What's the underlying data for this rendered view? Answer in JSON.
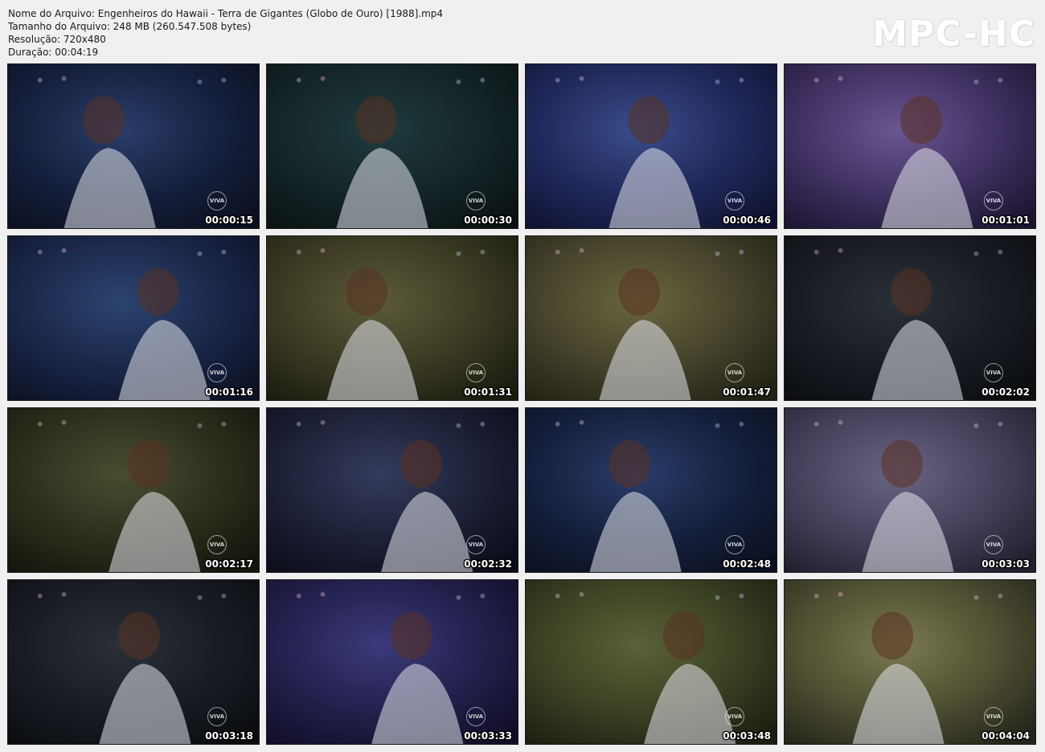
{
  "file_info": {
    "filename": "Nome do Arquivo: Engenheiros do Hawaii - Terra de Gigantes (Globo de Ouro) [1988].mp4",
    "filesize": "Tamanho do Arquivo: 248 MB (260.547.508 bytes)",
    "resolution": "Resolução: 720x480",
    "duration": "Duração: 00:04:19"
  },
  "branding": {
    "app_logo": "MPC-HC",
    "channel_logo": "VIVA"
  },
  "thumbnails": [
    {
      "timestamp": "00:00:15",
      "palette": "blue-dark"
    },
    {
      "timestamp": "00:00:30",
      "palette": "dark-teal"
    },
    {
      "timestamp": "00:00:46",
      "palette": "blue-stage"
    },
    {
      "timestamp": "00:01:01",
      "palette": "purple"
    },
    {
      "timestamp": "00:01:16",
      "palette": "blue-crowd"
    },
    {
      "timestamp": "00:01:31",
      "palette": "olive"
    },
    {
      "timestamp": "00:01:47",
      "palette": "olive-overlay"
    },
    {
      "timestamp": "00:02:02",
      "palette": "stage-top"
    },
    {
      "timestamp": "00:02:17",
      "palette": "olive-crowd"
    },
    {
      "timestamp": "00:02:32",
      "palette": "stage-wide"
    },
    {
      "timestamp": "00:02:48",
      "palette": "blue-dark"
    },
    {
      "timestamp": "00:03:03",
      "palette": "purple-grey"
    },
    {
      "timestamp": "00:03:18",
      "palette": "stage-top"
    },
    {
      "timestamp": "00:03:33",
      "palette": "blue-purple"
    },
    {
      "timestamp": "00:03:48",
      "palette": "olive-green"
    },
    {
      "timestamp": "00:04:04",
      "palette": "olive-light"
    }
  ],
  "colors": {
    "background": "#f0f0f0",
    "text": "#1a1a1a",
    "logo": "#ffffff"
  }
}
